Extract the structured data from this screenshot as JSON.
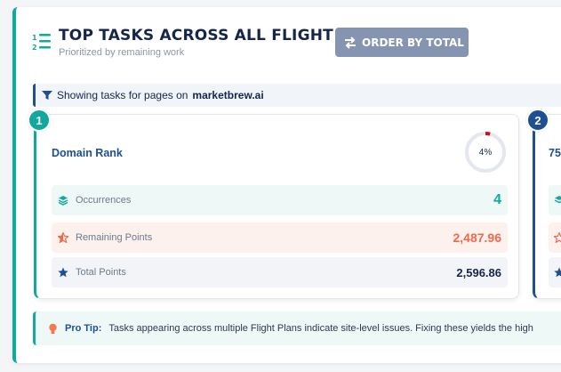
{
  "header": {
    "title": "TOP TASKS ACROSS ALL FLIGHT PLANS",
    "subtitle": "Prioritized by remaining work",
    "order_button_label": "ORDER BY TOTAL",
    "icon": "numbered-list-icon"
  },
  "filter": {
    "prefix": "Showing tasks for pages on",
    "domain": "marketbrew.ai",
    "icon": "filter-icon"
  },
  "cards": [
    {
      "rank": "1",
      "title": "Domain Rank",
      "progress_label": "4%",
      "progress_value": 4,
      "stats": [
        {
          "label": "Occurrences",
          "value": "4",
          "icon": "layers-icon"
        },
        {
          "label": "Remaining Points",
          "value": "2,487.96",
          "icon": "star-half-icon"
        },
        {
          "label": "Total Points",
          "value": "2,596.86",
          "icon": "star-icon"
        }
      ]
    },
    {
      "rank": "2",
      "title": "75"
    }
  ],
  "tip": {
    "label": "Pro Tip:",
    "text": "Tasks appearing across multiple Flight Plans indicate site-level issues. Fixing these yields the high",
    "icon": "lightbulb-icon"
  },
  "colors": {
    "teal": "#13a89e",
    "navy": "#1d4f91",
    "coral": "#ef6a4c",
    "button": "#8595b1"
  }
}
